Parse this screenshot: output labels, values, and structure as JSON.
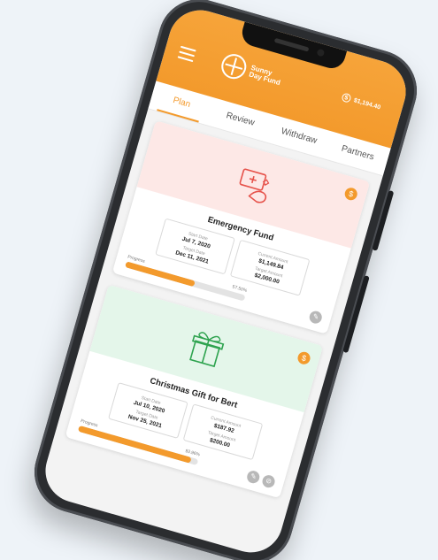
{
  "app": {
    "logo_text": "Sunny Day Fund",
    "balance": "$1,194.40"
  },
  "tabs": [
    {
      "label": "Plan",
      "active": true
    },
    {
      "label": "Review",
      "active": false
    },
    {
      "label": "Withdraw",
      "active": false
    },
    {
      "label": "Partners",
      "active": false
    }
  ],
  "funds": [
    {
      "title": "Emergency Fund",
      "icon": "first-aid-hand-icon",
      "accent": "#e6524a",
      "start_label": "Start Date",
      "start_value": "Jul 7, 2020",
      "target_date_label": "Target Date",
      "target_date_value": "Dec 11, 2021",
      "current_label": "Current Amount",
      "current_value": "$1,149.84",
      "target_amount_label": "Target Amount",
      "target_amount_value": "$2,000.00",
      "progress_label": "Progress",
      "progress_text": "57.50%",
      "progress": 0.575
    },
    {
      "title": "Christmas Gift for Bert",
      "icon": "gift-icon",
      "accent": "#2ea34f",
      "start_label": "Start Date",
      "start_value": "Jul 10, 2020",
      "target_date_label": "Target Date",
      "target_date_value": "Nov 25, 2021",
      "current_label": "Current Amount",
      "current_value": "$187.92",
      "target_amount_label": "Target Amount",
      "target_amount_value": "$200.00",
      "progress_label": "Progress",
      "progress_text": "93.96%",
      "progress": 0.9396
    }
  ],
  "colors": {
    "brand_orange": "#f39a2c",
    "background": "#eef3f8"
  }
}
